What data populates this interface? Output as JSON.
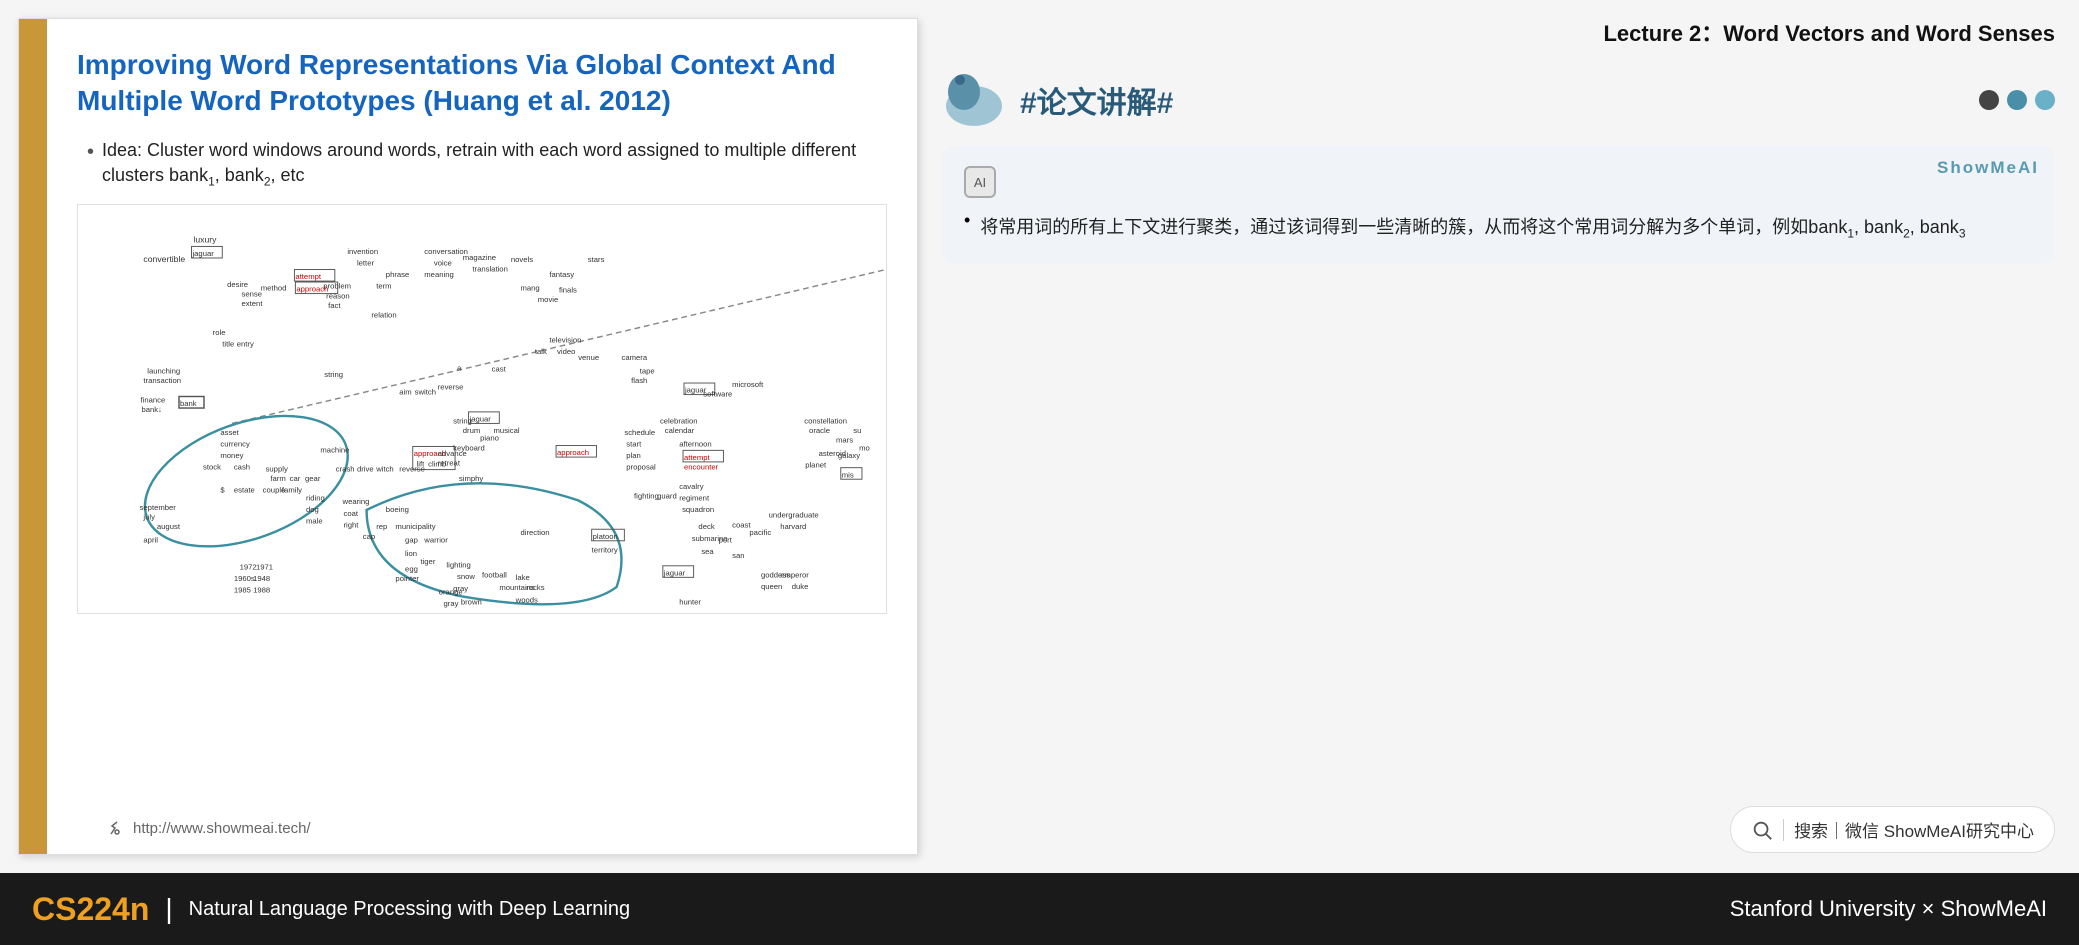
{
  "lecture": {
    "title": "Lecture 2：Word Vectors and Word Senses"
  },
  "slide": {
    "title": "Improving Word Representations Via Global Context And Multiple Word Prototypes (Huang et al. 2012)",
    "bullet": "Idea: Cluster word windows around words, retrain with each word assigned to multiple different clusters bank",
    "bullet_subs": [
      "1",
      "2"
    ],
    "bullet_suffix": ", etc",
    "url": "http://www.showmeai.tech/"
  },
  "annotation": {
    "tag": "#论文讲解#",
    "brand": "ShowMeAI",
    "text": "将常用词的所有上下文进行聚类，通过该词得到一些清晰的簇，从而将这个常用词分解为多个单词，例如bank₁, bank₂, bank₃",
    "ai_label": "AI"
  },
  "search": {
    "text": "搜索｜微信 ShowMeAI研究中心"
  },
  "bottom": {
    "course_code": "CS224n",
    "divider": "|",
    "course_name": "Natural Language Processing with Deep Learning",
    "right_text": "Stanford University × ShowMeAI"
  },
  "dots": [
    {
      "id": "dot1",
      "color": "dark"
    },
    {
      "id": "dot2",
      "color": "teal"
    },
    {
      "id": "dot3",
      "color": "teal-light"
    }
  ]
}
